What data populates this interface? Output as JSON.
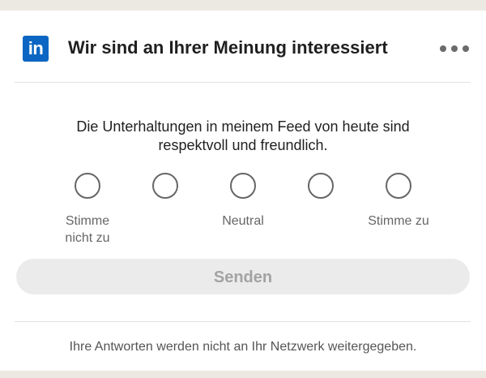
{
  "header": {
    "logo_text": "in",
    "title": "Wir sind an Ihrer Meinung interessiert",
    "more_icon": "more-horizontal-icon"
  },
  "survey": {
    "question_line1": "Die Unterhaltungen in meinem Feed von heute sind",
    "question_line2": "respektvoll und freundlich.",
    "options_count": 5,
    "labels": {
      "left_line1": "Stimme",
      "left_line2": "nicht zu",
      "middle": "Neutral",
      "right": "Stimme zu"
    },
    "submit_label": "Senden",
    "footer_note": "Ihre Antworten werden nicht an Ihr Netzwerk weitergegeben."
  },
  "colors": {
    "brand": "#0a66c2",
    "disabled_button_bg": "#ebebeb",
    "disabled_button_text": "#a3a3a3"
  }
}
